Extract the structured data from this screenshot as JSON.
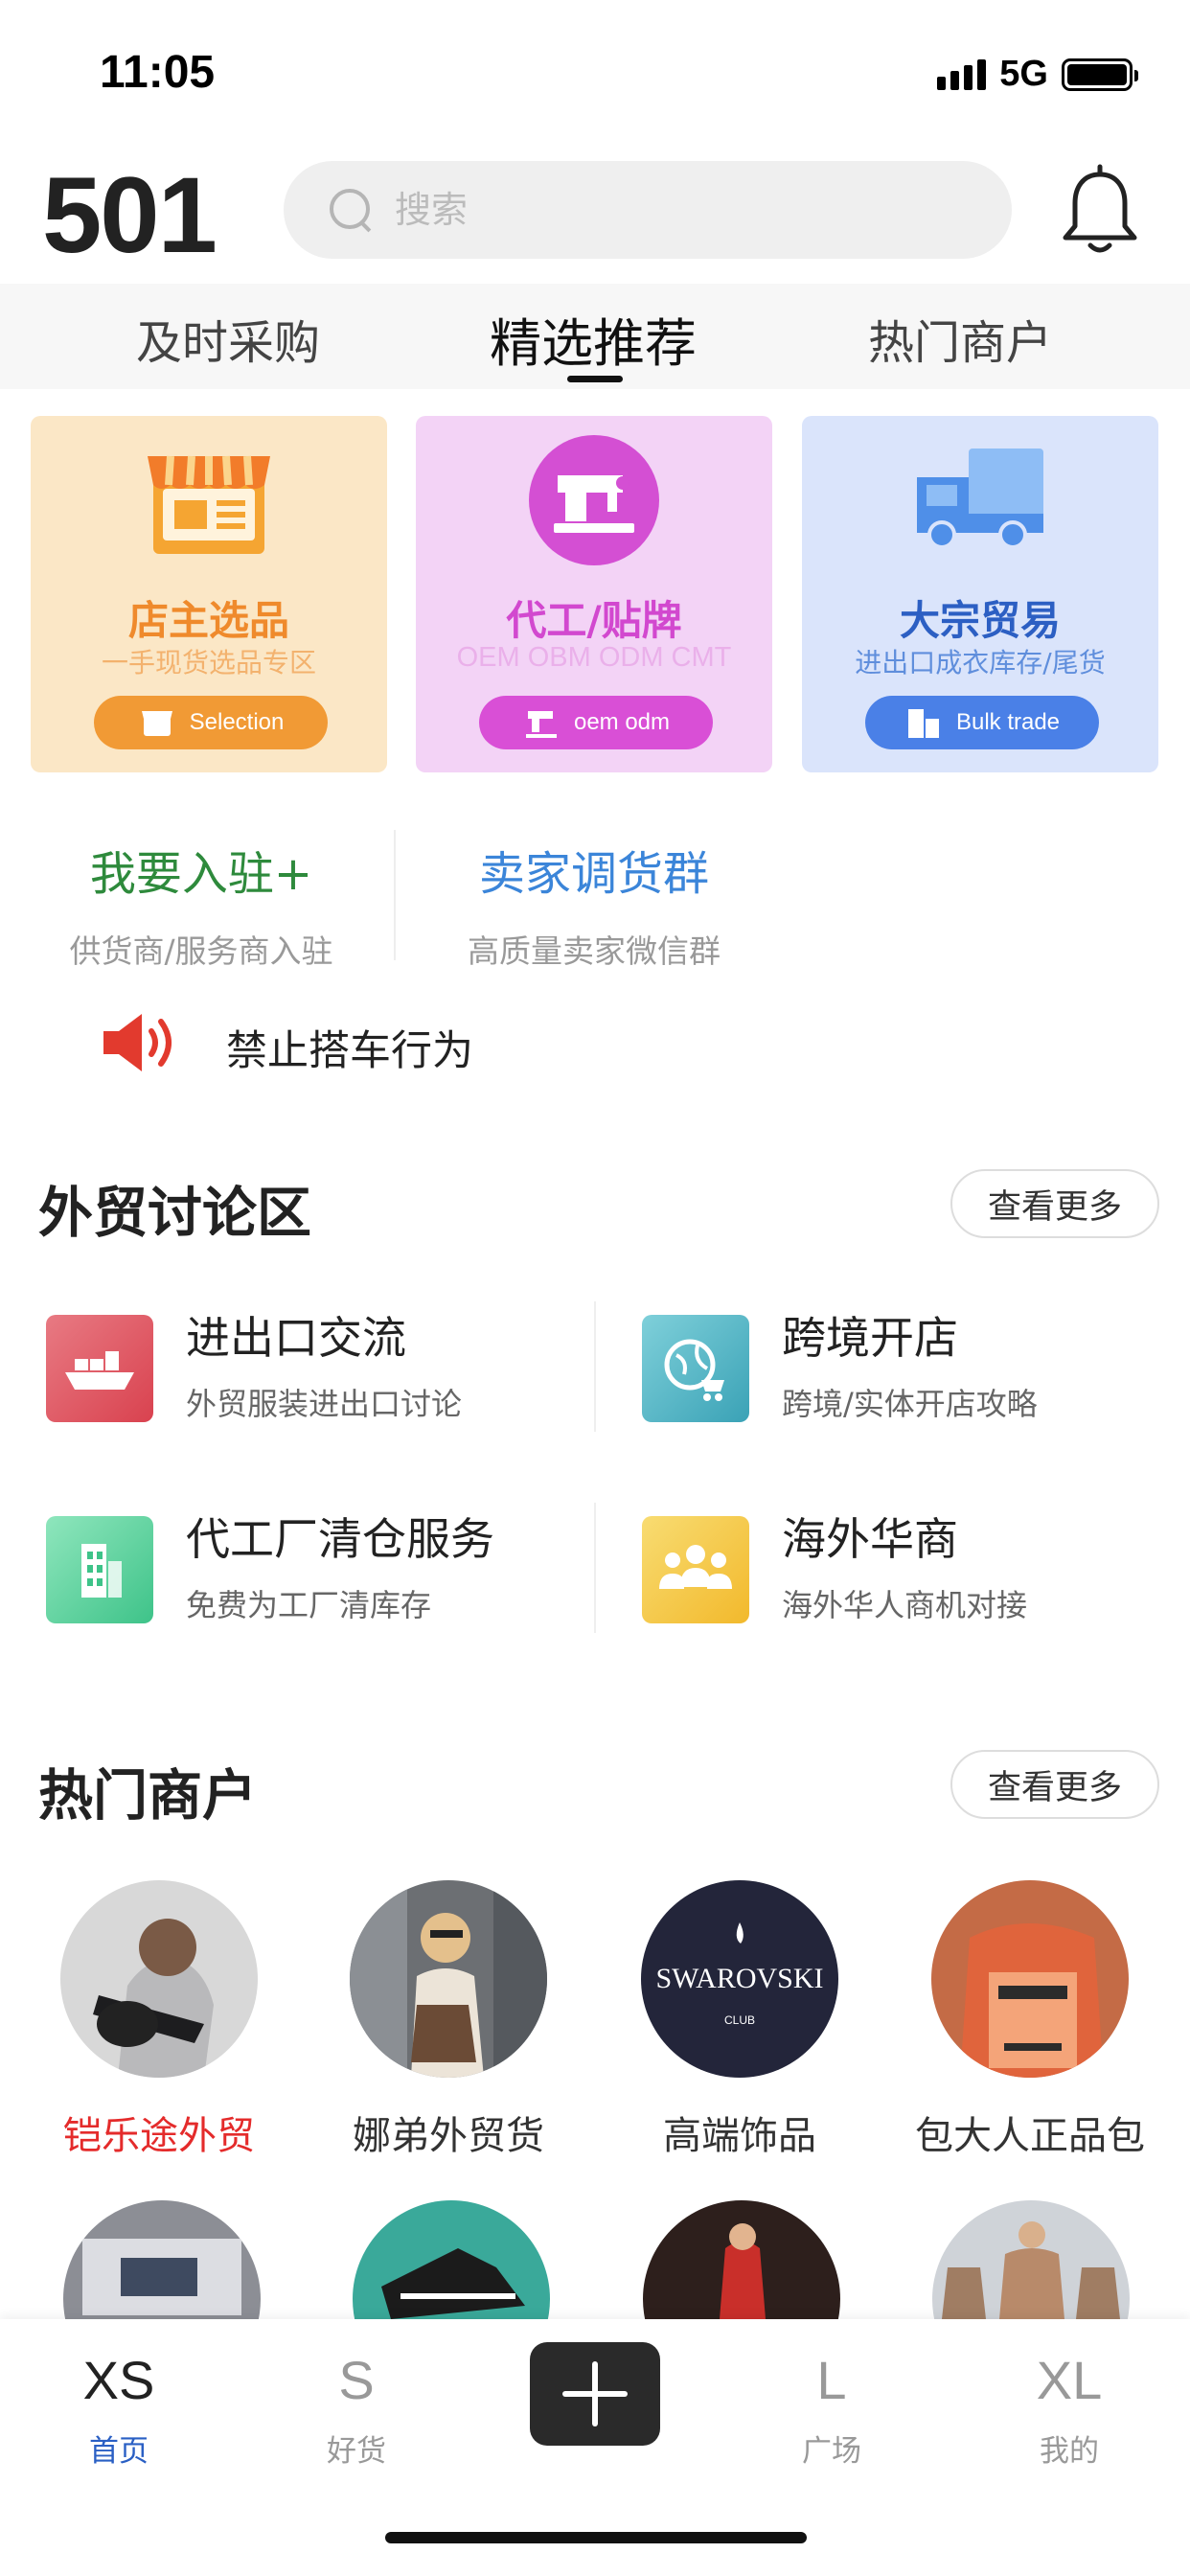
{
  "status_bar": {
    "time": "11:05",
    "network": "5G"
  },
  "header": {
    "logo": "501",
    "search_placeholder": "搜索"
  },
  "tabs": [
    {
      "label": "及时采购"
    },
    {
      "label": "精选推荐",
      "active": true
    },
    {
      "label": "热门商户"
    }
  ],
  "categories": [
    {
      "title": "店主选品",
      "subtitle": "一手现货选品专区",
      "pill": "Selection",
      "icon": "shop-icon",
      "color": "#f19a35"
    },
    {
      "title": "代工/贴牌",
      "subtitle": "OEM OBM ODM CMT",
      "pill": "oem odm",
      "icon": "sewing-machine-icon",
      "color": "#d94fd6"
    },
    {
      "title": "大宗贸易",
      "subtitle": "进出口成衣库存/尾货",
      "pill": "Bulk trade",
      "icon": "truck-icon",
      "color": "#4a80e7"
    }
  ],
  "join": [
    {
      "title": "我要入驻+",
      "subtitle": "供货商/服务商入驻"
    },
    {
      "title": "卖家调货群",
      "subtitle": "高质量卖家微信群"
    }
  ],
  "notice": {
    "text": "禁止搭车行为"
  },
  "forum": {
    "title": "外贸讨论区",
    "more": "查看更多",
    "items": [
      {
        "title": "进出口交流",
        "subtitle": "外贸服装进出口讨论",
        "icon": "cargo-ship-icon",
        "color": "#e05a65"
      },
      {
        "title": "跨境开店",
        "subtitle": "跨境/实体开店攻略",
        "icon": "globe-cart-icon",
        "color": "#4eb2c3"
      },
      {
        "title": "代工厂清仓服务",
        "subtitle": "免费为工厂清库存",
        "icon": "building-icon",
        "color": "#4fcd9a"
      },
      {
        "title": "海外华商",
        "subtitle": "海外华人商机对接",
        "icon": "people-icon",
        "color": "#f3c43e"
      }
    ]
  },
  "merchants": {
    "title": "热门商户",
    "more": "查看更多",
    "items": [
      {
        "name": "铠乐途外贸",
        "highlight": true
      },
      {
        "name": "娜弟外贸货"
      },
      {
        "name": "高端饰品",
        "avatar_text": "SWAROVSKI",
        "avatar_sub": "CLUB"
      },
      {
        "name": "包大人正品包"
      }
    ]
  },
  "bottom_nav": [
    {
      "big": "XS",
      "label": "首页",
      "active": true
    },
    {
      "big": "S",
      "label": "好货"
    },
    {
      "big": "L",
      "label": "广场"
    },
    {
      "big": "XL",
      "label": "我的"
    }
  ]
}
